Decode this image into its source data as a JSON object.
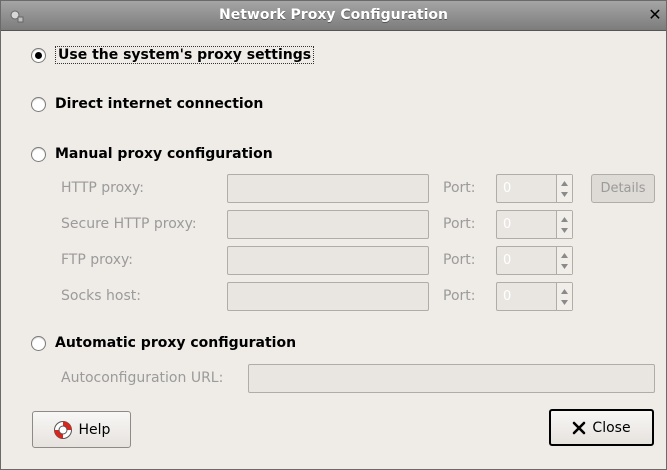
{
  "window": {
    "title": "Network Proxy Configuration",
    "close_glyph": "✕"
  },
  "options": {
    "system": {
      "label": "Use the system's proxy settings",
      "selected": true
    },
    "direct": {
      "label": "Direct internet connection",
      "selected": false
    },
    "manual": {
      "label": "Manual proxy configuration",
      "selected": false
    },
    "automatic": {
      "label": "Automatic proxy configuration",
      "selected": false
    }
  },
  "manual": {
    "http": {
      "label": "HTTP proxy:",
      "value": "",
      "port_label": "Port:",
      "port": "0"
    },
    "secure": {
      "label": "Secure HTTP proxy:",
      "value": "",
      "port_label": "Port:",
      "port": "0"
    },
    "ftp": {
      "label": "FTP proxy:",
      "value": "",
      "port_label": "Port:",
      "port": "0"
    },
    "socks": {
      "label": "Socks host:",
      "value": "",
      "port_label": "Port:",
      "port": "0"
    },
    "details_label": "Details"
  },
  "automatic": {
    "url_label": "Autoconfiguration URL:",
    "url_value": ""
  },
  "buttons": {
    "help_label": "Help",
    "close_label": "Close"
  },
  "icons": {
    "help": "lifebuoy-icon",
    "close": "x-icon",
    "title": "network-icon"
  },
  "colors": {
    "titlebar": "#8c8c8c",
    "background": "#efebe7",
    "disabled_text": "#9b9b9b"
  }
}
